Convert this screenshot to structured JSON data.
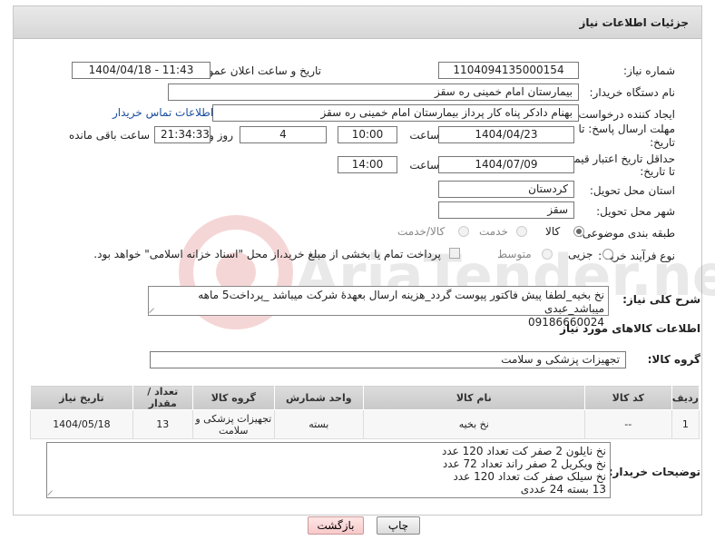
{
  "header": {
    "title": "جزئیات اطلاعات نیاز"
  },
  "fields": {
    "need_number": {
      "label": "شماره نیاز:",
      "value": "1104094135000154"
    },
    "announce": {
      "label": "تاریخ و ساعت اعلان عمومی:",
      "value": "1404/04/18 - 11:43"
    },
    "buyer_org": {
      "label": "نام دستگاه خریدار:",
      "value": "بیمارستان امام خمینی  ره  سقز"
    },
    "creator": {
      "label": "ایجاد کننده درخواست:",
      "value": "بهنام دادکر پناه کار پرداز بیمارستان امام خمینی  ره  سقز",
      "contact_link": "اطلاعات تماس خریدار"
    },
    "reply_deadline": {
      "label_line1": "مهلت ارسال پاسخ: تا",
      "label_line2": "تاریخ:",
      "date": "1404/04/23",
      "time_label": "ساعت",
      "time": "10:00",
      "days": "4",
      "days_label": "روز و",
      "remaining": "21:34:33",
      "remaining_label": "ساعت باقی مانده"
    },
    "price_validity": {
      "label_line1": "حداقل تاریخ اعتبار قیمت:",
      "label_line2": "تا تاریخ:",
      "date": "1404/07/09",
      "time_label": "ساعت",
      "time": "14:00"
    },
    "province": {
      "label": "استان محل تحویل:",
      "value": "کردستان"
    },
    "city": {
      "label": "شهر محل تحویل:",
      "value": "سقز"
    },
    "category": {
      "label": "طبقه بندی موضوعی:",
      "options": [
        "کالا",
        "خدمت",
        "کالا/خدمت"
      ],
      "selected": "کالا"
    },
    "process": {
      "label": "نوع فرآیند خرید :",
      "options": [
        "جزیی",
        "متوسط"
      ],
      "selected": "جزیی",
      "payment_note": "پرداخت تمام یا بخشی از مبلغ خرید،از محل \"اسناد خزانه اسلامی\" خواهد بود."
    }
  },
  "description": {
    "label": "شرح کلی نیاز:",
    "line1": "نخ بخیه_لطفا پیش فاکتور پیوست گردد_هزینه ارسال بعهدهٔ شرکت میباشد _پرداخت5 ماهه میباشد_عبدی",
    "line2": "09186660024"
  },
  "goods": {
    "section_title": "اطلاعات کالاهای مورد نیاز",
    "group_label": "گروه کالا:",
    "group_value": "تجهیزات پزشکی و سلامت",
    "columns": [
      "ردیف",
      "کد کالا",
      "نام کالا",
      "واحد شمارش",
      "گروه کالا",
      "تعداد / مقدار",
      "تاریخ نیاز"
    ],
    "rows": [
      {
        "row": "1",
        "code": "--",
        "name": "نخ بخیه",
        "unit": "بسته",
        "group": "تجهیزات پزشکی و سلامت",
        "qty": "13",
        "date": "1404/05/18"
      }
    ]
  },
  "buyer_notes": {
    "label": "توضیحات خریدار:",
    "lines": [
      "نخ نایلون  2  صفر کت     تعداد   120   عدد",
      "نخ ویکریل  2  صفر راند    تعداد    72   عدد",
      "نخ سیلک  صفر کت        تعداد  120  عدد",
      "13  بسته 24  عددی"
    ]
  },
  "buttons": {
    "print": "چاپ",
    "back": "بازگشت"
  },
  "watermark": {
    "text": "AriaTender.neT"
  }
}
